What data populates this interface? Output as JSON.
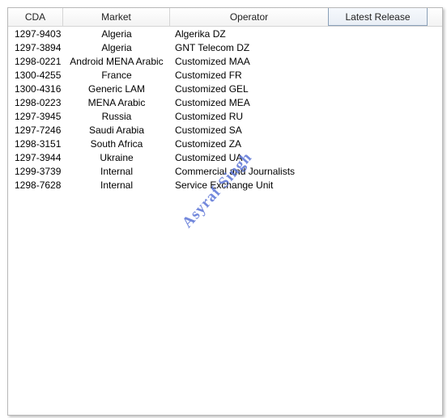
{
  "columns": {
    "cda": "CDA",
    "market": "Market",
    "operator": "Operator",
    "latest_release": "Latest Release"
  },
  "rows": [
    {
      "cda": "1297-9403",
      "market": "Algeria",
      "operator": "Algerika DZ"
    },
    {
      "cda": "1297-3894",
      "market": "Algeria",
      "operator": "GNT Telecom DZ"
    },
    {
      "cda": "1298-0221",
      "market": "Android MENA Arabic",
      "operator": "Customized MAA"
    },
    {
      "cda": "1300-4255",
      "market": "France",
      "operator": "Customized FR"
    },
    {
      "cda": "1300-4316",
      "market": "Generic LAM",
      "operator": "Customized GEL"
    },
    {
      "cda": "1298-0223",
      "market": "MENA Arabic",
      "operator": "Customized MEA"
    },
    {
      "cda": "1297-3945",
      "market": "Russia",
      "operator": "Customized RU"
    },
    {
      "cda": "1297-7246",
      "market": "Saudi Arabia",
      "operator": "Customized SA"
    },
    {
      "cda": "1298-3151",
      "market": "South Africa",
      "operator": "Customized ZA"
    },
    {
      "cda": "1297-3944",
      "market": "Ukraine",
      "operator": "Customized UA"
    },
    {
      "cda": "1299-3739",
      "market": "Internal",
      "operator": "Commercial and Journalists"
    },
    {
      "cda": "1298-7628",
      "market": "Internal",
      "operator": "Service Exchange Unit"
    }
  ],
  "watermark": "Asyraf Singh"
}
